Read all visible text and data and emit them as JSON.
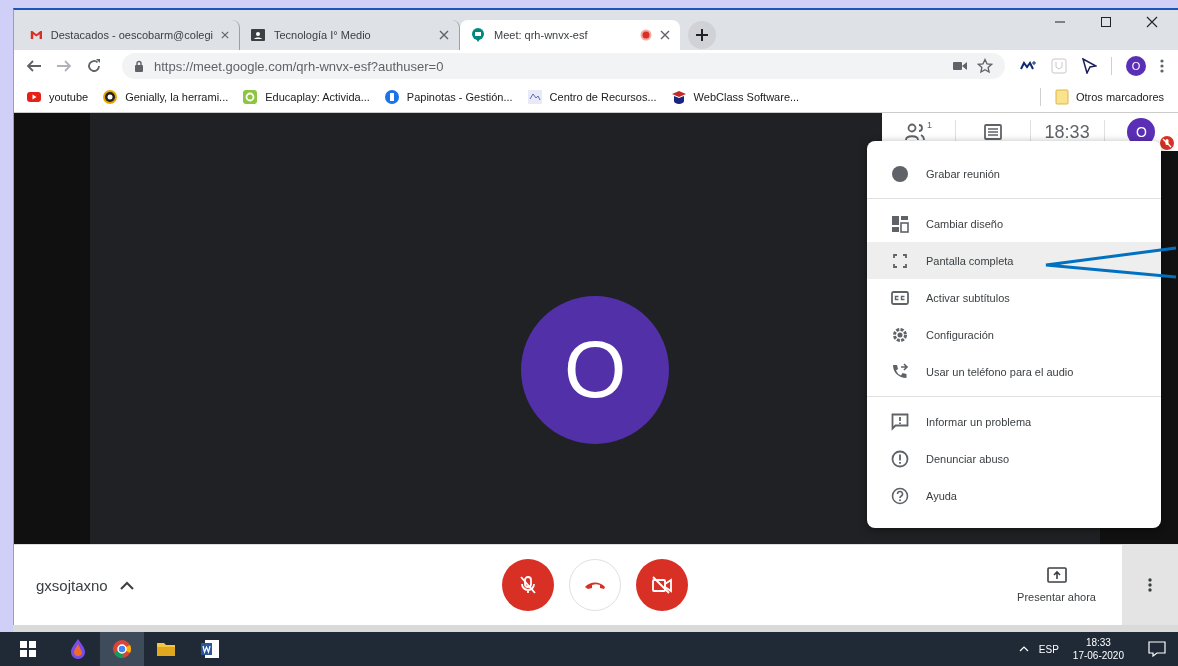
{
  "tabs": [
    {
      "title": "Destacados - oescobarm@colegi",
      "selected": false,
      "recording": false
    },
    {
      "title": "Tecnología I° Medio",
      "selected": false,
      "recording": false
    },
    {
      "title": "Meet: qrh-wnvx-esf",
      "selected": true,
      "recording": true
    }
  ],
  "toolbar": {
    "url": "https://meet.google.com/qrh-wnvx-esf?authuser=0",
    "profile_initial": "O"
  },
  "bookmarks": [
    "youtube",
    "Genially, la herrami...",
    "Educaplay: Activida...",
    "Papinotas - Gestión...",
    "Centro de Recursos...",
    "WebClass Software..."
  ],
  "other_bookmarks": "Otros marcadores",
  "meet_header": {
    "participants_count": "1",
    "time": "18:33",
    "avatar": "O",
    "mic_muted": true
  },
  "stage": {
    "avatar": "O"
  },
  "menu": {
    "groups": [
      [
        {
          "label": "Grabar reunión",
          "selected": false
        }
      ],
      [
        {
          "label": "Cambiar diseño",
          "selected": false
        },
        {
          "label": "Pantalla completa",
          "selected": true
        },
        {
          "label": "Activar subtítulos",
          "selected": false
        },
        {
          "label": "Configuración",
          "selected": false
        },
        {
          "label": "Usar un teléfono para el audio",
          "selected": false
        }
      ],
      [
        {
          "label": "Informar un problema",
          "selected": false
        },
        {
          "label": "Denunciar abuso",
          "selected": false
        },
        {
          "label": "Ayuda",
          "selected": false
        }
      ]
    ]
  },
  "bottom_bar": {
    "meeting_code": "gxsojtaxno",
    "mic_on": false,
    "camera_on": false,
    "present": "Presentar ahora"
  },
  "taskbar": {
    "language": "ESP",
    "time": "18:33",
    "date": "17-06-2020"
  }
}
